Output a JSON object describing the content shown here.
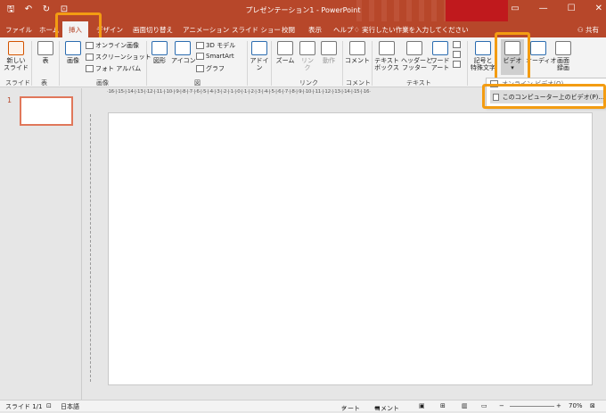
{
  "titlebar": {
    "title": "プレゼンテーション1 - PowerPoint",
    "qat_icons": [
      "save-icon",
      "undo-icon",
      "redo-icon",
      "present-icon"
    ],
    "window_buttons": [
      "▭",
      "—",
      "☐",
      "✕"
    ]
  },
  "tabs": [
    "ファイル",
    "ホーム",
    "挿入",
    "デザイン",
    "画面切り替え",
    "アニメーション",
    "スライド ショー",
    "校閲",
    "表示",
    "ヘルプ"
  ],
  "active_tab": "挿入",
  "tell_me": "実行したい作業を入力してください",
  "share": "共有",
  "ribbon": {
    "new_slide": "新しい\nスライド",
    "table": "表",
    "image": "画像",
    "online_image": "オンライン画像",
    "screenshot": "スクリーンショット",
    "photo_album": "フォト アルバム",
    "shapes": "図形",
    "icons": "アイコン",
    "model3d": "3D モデル",
    "smartart": "SmartArt",
    "graph": "グラフ",
    "addin": "アドイ\nン",
    "zoom": "ズーム",
    "link": "リン\nク",
    "action": "動作",
    "comment": "コメント",
    "textbox": "テキスト\nボックス",
    "header_footer": "ヘッダーと\nフッター",
    "wordart": "ワード\nアート",
    "symbol": "記号と\n特殊文字",
    "video": "ビデオ",
    "audio": "オーディオ",
    "screen_record": "画面\n録画",
    "groups": [
      "スライド",
      "表",
      "画像",
      "図",
      "リンク",
      "コメント",
      "テキスト"
    ]
  },
  "dropdown": {
    "online_video": "オンライン ビデオ(O)...",
    "pc_video": "このコンピューター上のビデオ(P)..."
  },
  "slide_number": "1",
  "ruler": "·16·|·15·|·14·|·13·|·12·|·11·|·10·|·9·|·8·|·7·|·6·|·5·|·4·|·3·|·2·|·1·|·0·|·1·|·2·|·3·|·4·|·5·|·6·|·7·|·8·|·9·|·10·|·11·|·12·|·13·|·14·|·15·|·16·",
  "status": {
    "slide": "スライド 1/1",
    "lang": "日本語",
    "note": "ノート",
    "comment": "コメント",
    "zoom": "70%"
  },
  "colors": {
    "accent": "#b7472a",
    "highlight": "#f39c12"
  }
}
